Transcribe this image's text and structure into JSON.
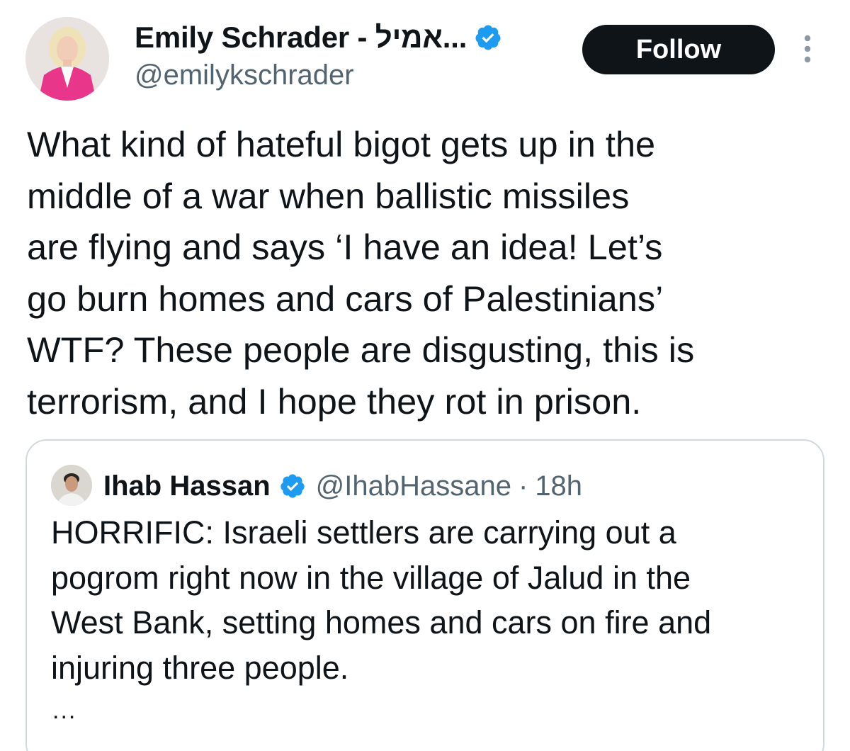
{
  "author": {
    "display_name": "Emily Schrader - אמיל...",
    "handle": "@emilykschrader",
    "verified": true,
    "avatar_icon": "profile-photo"
  },
  "actions": {
    "follow_label": "Follow",
    "more_icon": "vertical-ellipsis-icon"
  },
  "tweet": {
    "text": "What kind of hateful bigot gets up in the\nmiddle of a war when ballistic missiles\nare flying and says ‘I have an idea! Let’s\ngo burn homes and cars of Palestinians’\nWTF? These people are disgusting, this is\nterrorism, and I hope they rot in prison."
  },
  "quoted_tweet": {
    "display_name": "Ihab Hassan",
    "handle": "@IhabHassane",
    "separator": "·",
    "time": "18h",
    "verified": true,
    "text": "HORRIFIC: Israeli settlers are carrying out a\npogrom right now in the village of Jalud in the\nWest Bank, setting homes and cars on fire and\ninjuring three people.",
    "truncation": "..."
  },
  "colors": {
    "primary_text": "#0f1419",
    "secondary_text": "#536471",
    "verified_blue": "#1d9bf0",
    "border": "#cfd9de",
    "follow_bg": "#0f1419",
    "follow_text": "#ffffff"
  }
}
